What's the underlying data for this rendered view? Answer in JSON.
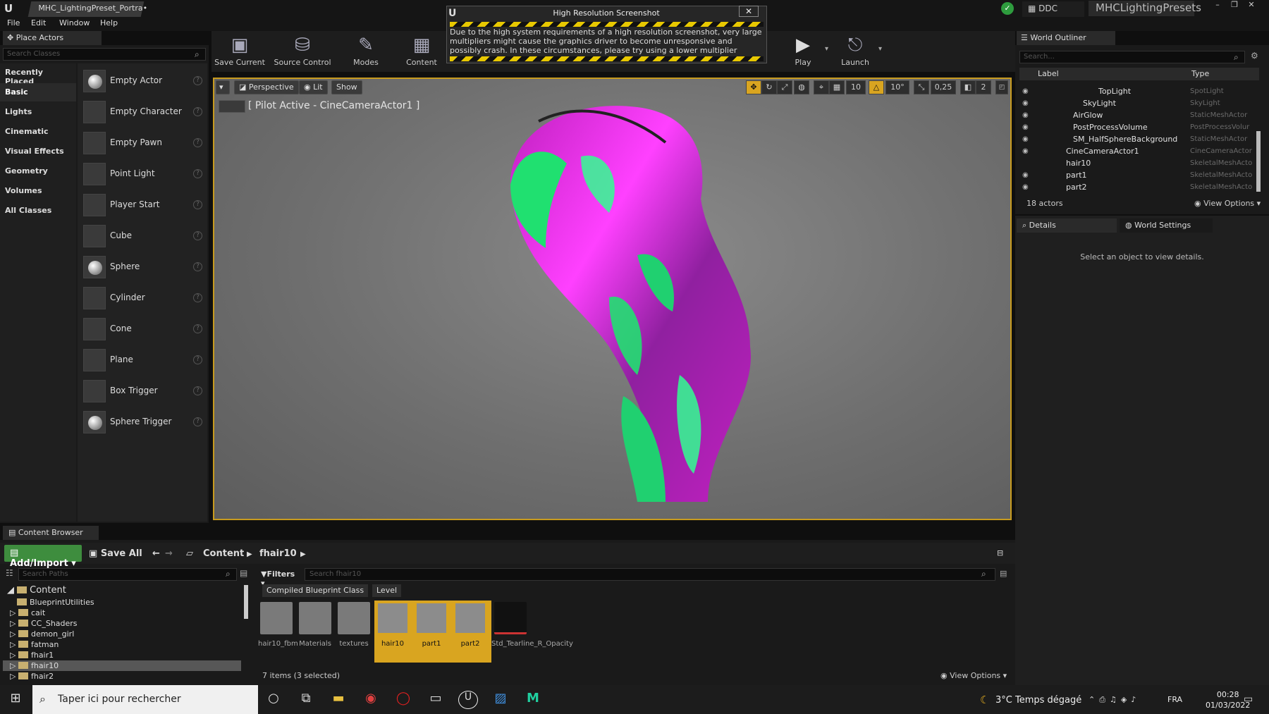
{
  "window": {
    "doc_tab": "MHC_LightingPreset_Portra•",
    "ddc_label": "DDC",
    "project_name": "MHCLightingPresets"
  },
  "menu": [
    "File",
    "Edit",
    "Window",
    "Help"
  ],
  "place_actors": {
    "tab_label": "Place Actors",
    "search_placeholder": "Search Classes",
    "categories": [
      "Recently Placed",
      "Basic",
      "Lights",
      "Cinematic",
      "Visual Effects",
      "Geometry",
      "Volumes",
      "All Classes"
    ],
    "active_category": "Basic",
    "actors": [
      "Empty Actor",
      "Empty Character",
      "Empty Pawn",
      "Point Light",
      "Player Start",
      "Cube",
      "Sphere",
      "Cylinder",
      "Cone",
      "Plane",
      "Box Trigger",
      "Sphere Trigger"
    ]
  },
  "toolbar": {
    "save_current": "Save Current",
    "source_control": "Source Control",
    "modes": "Modes",
    "content": "Content",
    "play": "Play",
    "launch": "Launch"
  },
  "popup": {
    "title": "High Resolution Screenshot",
    "text": "Due to the high system requirements of a high resolution screenshot, very large multipliers might cause the graphics driver to become unresponsive and possibly crash. In these circumstances, please try using a lower multiplier"
  },
  "viewport": {
    "perspective": "Perspective",
    "lit": "Lit",
    "show": "Show",
    "pilot_label": "[ Pilot Active - CineCameraActor1 ]",
    "grid_snap": "10",
    "rot_snap": "10°",
    "scale_snap": "0,25",
    "cam_speed": "2"
  },
  "outliner": {
    "tab_label": "World Outliner",
    "search_placeholder": "Search...",
    "col_label": "Label",
    "col_type": "Type",
    "rows": [
      {
        "name": "TopLight",
        "type": "SpotLight"
      },
      {
        "name": "SkyLight",
        "type": "SkyLight"
      },
      {
        "name": "AirGlow",
        "type": "StaticMeshActor"
      },
      {
        "name": "PostProcessVolume",
        "type": "PostProcessVolur"
      },
      {
        "name": "SM_HalfSphereBackground",
        "type": "StaticMeshActor"
      },
      {
        "name": "CineCameraActor1",
        "type": "CineCameraActor"
      },
      {
        "name": "hair10",
        "type": "SkeletalMeshActo"
      },
      {
        "name": "part1",
        "type": "SkeletalMeshActo"
      },
      {
        "name": "part2",
        "type": "SkeletalMeshActo"
      }
    ],
    "count": "18 actors",
    "view_options": "View Options"
  },
  "details": {
    "tab_label": "Details",
    "world_settings": "World Settings",
    "empty_msg": "Select an object to view details."
  },
  "content_browser": {
    "tab_label": "Content Browser",
    "add_import": "Add/Import",
    "save_all": "Save All",
    "crumb_root": "Content",
    "crumb_folder": "fhair10",
    "path_search": "Search Paths",
    "filters": "Filters",
    "asset_search": "Search fhair10",
    "chips": [
      "Compiled Blueprint Class",
      "Level"
    ],
    "tree": [
      "Content",
      "BlueprintUtilities",
      "cait",
      "CC_Shaders",
      "demon_girl",
      "fatman",
      "fhair1",
      "fhair10",
      "fhair2"
    ],
    "assets": [
      {
        "name": "hair10_fbm",
        "kind": "folder"
      },
      {
        "name": "Materials",
        "kind": "folder"
      },
      {
        "name": "textures",
        "kind": "folder"
      },
      {
        "name": "hair10",
        "kind": "mesh"
      },
      {
        "name": "part1",
        "kind": "mesh"
      },
      {
        "name": "part2",
        "kind": "mesh"
      },
      {
        "name": "Std_Tearline_R_Opacity",
        "kind": "texture"
      }
    ],
    "items_count": "7 items (3 selected)",
    "view_options": "View Options"
  },
  "taskbar": {
    "search_placeholder": "Taper ici pour rechercher",
    "weather": "3°C  Temps dégagé",
    "lang": "FRA",
    "time": "00:28",
    "date": "01/03/2022"
  },
  "colors": {
    "accent_yellow": "#d9a520",
    "add_green": "#3e8d3e",
    "hair_magenta": "#c020c0",
    "hair_green": "#20e070"
  }
}
